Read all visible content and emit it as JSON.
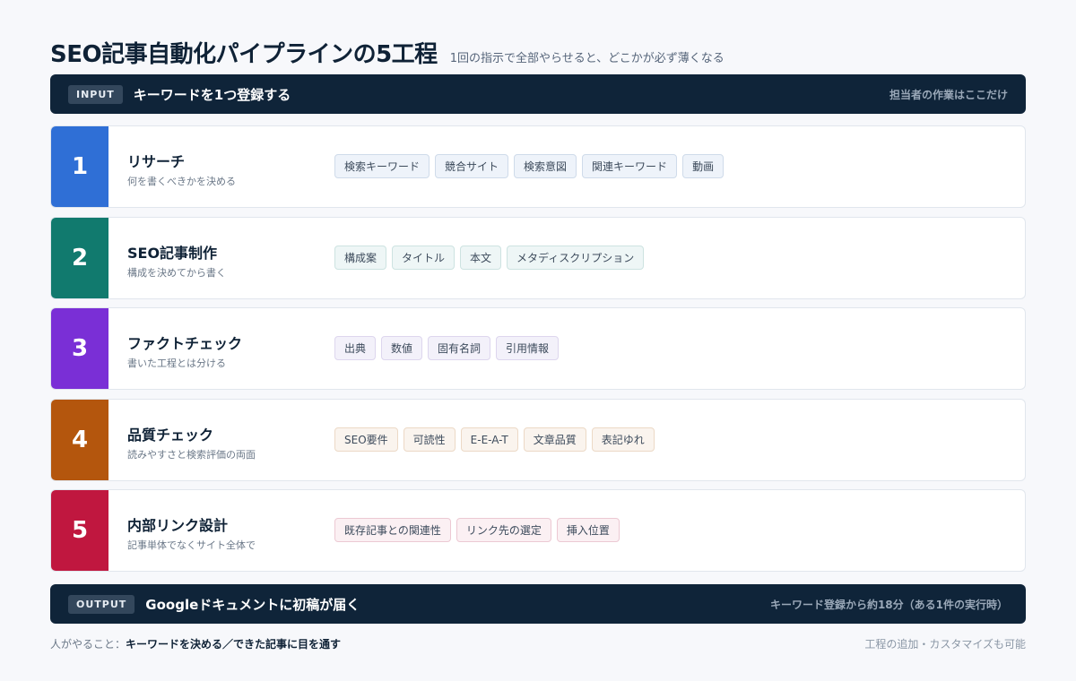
{
  "header": {
    "title": "SEO記事自動化パイプラインの5工程",
    "subtitle": "1回の指示で全部やらせると、どこかが必ず薄くなる"
  },
  "input_bar": {
    "tag": "INPUT",
    "title": "キーワードを1つ登録する",
    "note": "担当者の作業はここだけ"
  },
  "steps": [
    {
      "number": "1",
      "name": "リサーチ",
      "desc": "何を書くべきかを決める",
      "color": "#2f6fd6",
      "chip_bg": "#eef3fa",
      "chip_border": "#cfdbea",
      "chips": [
        "検索キーワード",
        "競合サイト",
        "検索意図",
        "関連キーワード",
        "動画"
      ]
    },
    {
      "number": "2",
      "name": "SEO記事制作",
      "desc": "構成を決めてから書く",
      "color": "#117a6e",
      "chip_bg": "#eef6f6",
      "chip_border": "#cde3e1",
      "chips": [
        "構成案",
        "タイトル",
        "本文",
        "メタディスクリプション"
      ]
    },
    {
      "number": "3",
      "name": "ファクトチェック",
      "desc": "書いた工程とは分ける",
      "color": "#7a2fd6",
      "chip_bg": "#f3f1fa",
      "chip_border": "#ddd6ee",
      "chips": [
        "出典",
        "数値",
        "固有名詞",
        "引用情報"
      ]
    },
    {
      "number": "4",
      "name": "品質チェック",
      "desc": "読みやすさと検索評価の両面",
      "color": "#b4560d",
      "chip_bg": "#faf4ee",
      "chip_border": "#ecd9c6",
      "chips": [
        "SEO要件",
        "可読性",
        "E-E-A-T",
        "文章品質",
        "表記ゆれ"
      ]
    },
    {
      "number": "5",
      "name": "内部リンク設計",
      "desc": "記事単体でなくサイト全体で",
      "color": "#c0173f",
      "chip_bg": "#fbf0f3",
      "chip_border": "#ecc9d3",
      "chips": [
        "既存記事との関連性",
        "リンク先の選定",
        "挿入位置"
      ]
    }
  ],
  "output_bar": {
    "tag": "OUTPUT",
    "title": "Googleドキュメントに初稿が届く",
    "note": "キーワード登録から約18分（ある1件の実行時）"
  },
  "footer": {
    "left_label": "人がやること：",
    "left_value": "キーワードを決める／できた記事に目を通す",
    "right": "工程の追加・カスタマイズも可能"
  }
}
